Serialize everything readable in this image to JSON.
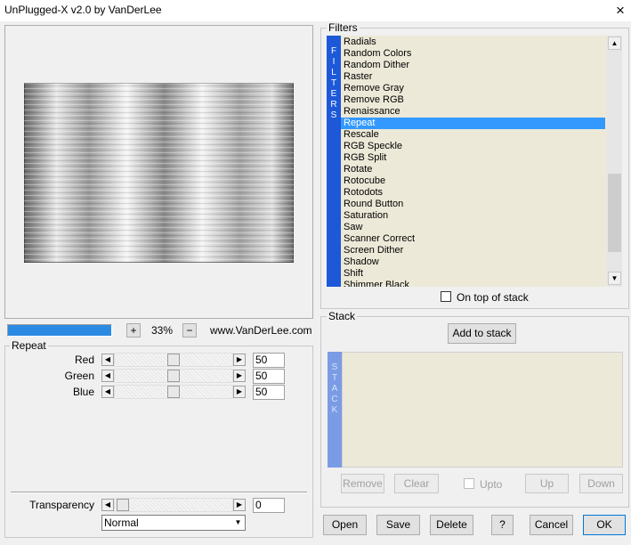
{
  "window": {
    "title": "UnPlugged-X v2.0 by VanDerLee",
    "close_icon": "×"
  },
  "preview": {
    "zoom": "33%",
    "plus": "+",
    "minus": "−",
    "website": "www.VanDerLee.com",
    "progress": 1.0
  },
  "repeat": {
    "group_label": "Repeat",
    "sliders": [
      {
        "label": "Red",
        "value": "50"
      },
      {
        "label": "Green",
        "value": "50"
      },
      {
        "label": "Blue",
        "value": "50"
      }
    ],
    "transparency": {
      "label": "Transparency",
      "value": "0"
    },
    "blend_mode": "Normal"
  },
  "filters": {
    "group_label": "Filters",
    "strip": "FILTERS",
    "items": [
      "Radials",
      "Random Colors",
      "Random Dither",
      "Raster",
      "Remove Gray",
      "Remove RGB",
      "Renaissance",
      "Repeat",
      "Rescale",
      "RGB Speckle",
      "RGB Split",
      "Rotate",
      "Rotocube",
      "Rotodots",
      "Round Button",
      "Saturation",
      "Saw",
      "Scanner Correct",
      "Screen Dither",
      "Shadow",
      "Shift",
      "Shimmer Black"
    ],
    "selected": "Repeat",
    "on_top_label": "On top of stack"
  },
  "stack": {
    "group_label": "Stack",
    "add_label": "Add to stack",
    "strip": "STACK",
    "remove": "Remove",
    "clear": "Clear",
    "upto": "Upto",
    "up": "Up",
    "down": "Down"
  },
  "footer": {
    "open": "Open",
    "save": "Save",
    "delete": "Delete",
    "help": "?",
    "cancel": "Cancel",
    "ok": "OK"
  }
}
